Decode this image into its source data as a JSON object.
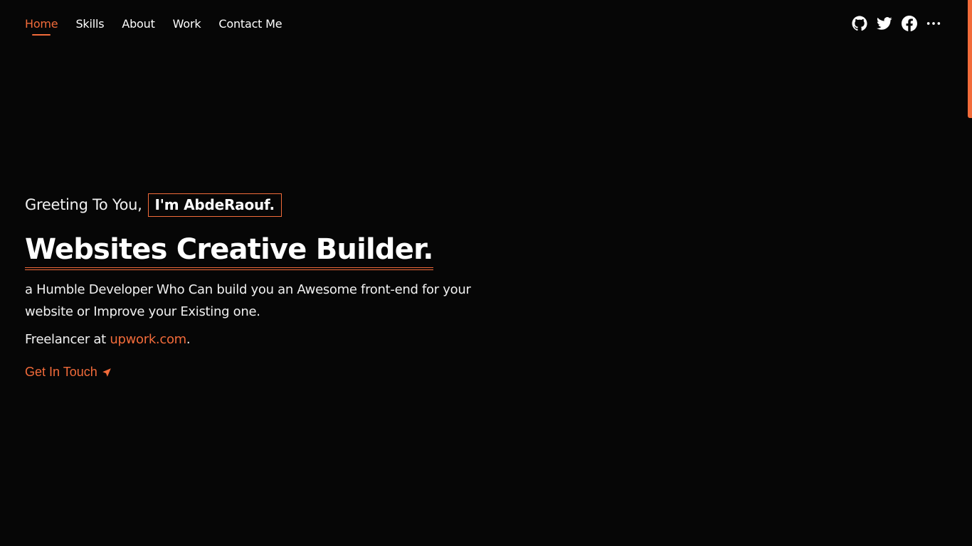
{
  "nav": {
    "items": [
      {
        "label": "Home",
        "active": true
      },
      {
        "label": "Skills"
      },
      {
        "label": "About"
      },
      {
        "label": "Work"
      },
      {
        "label": "Contact Me"
      }
    ]
  },
  "social": {
    "icons": [
      "github-icon",
      "twitter-icon",
      "facebook-icon",
      "more-icon"
    ]
  },
  "hero": {
    "greeting": "Greeting To You,",
    "name": "I'm AbdeRaouf.",
    "headline": "Websites Creative Builder.",
    "description": "a Humble Developer Who Can build you an Awesome front-end for your website or Improve your Existing one.",
    "freelance_prefix": "Freelancer at",
    "freelance_link": "upwork.com",
    "freelance_suffix": ".",
    "cta_label": "Get In Touch"
  },
  "colors": {
    "background": "#060606",
    "accent": "#f26b3a",
    "text": "#ffffff"
  }
}
